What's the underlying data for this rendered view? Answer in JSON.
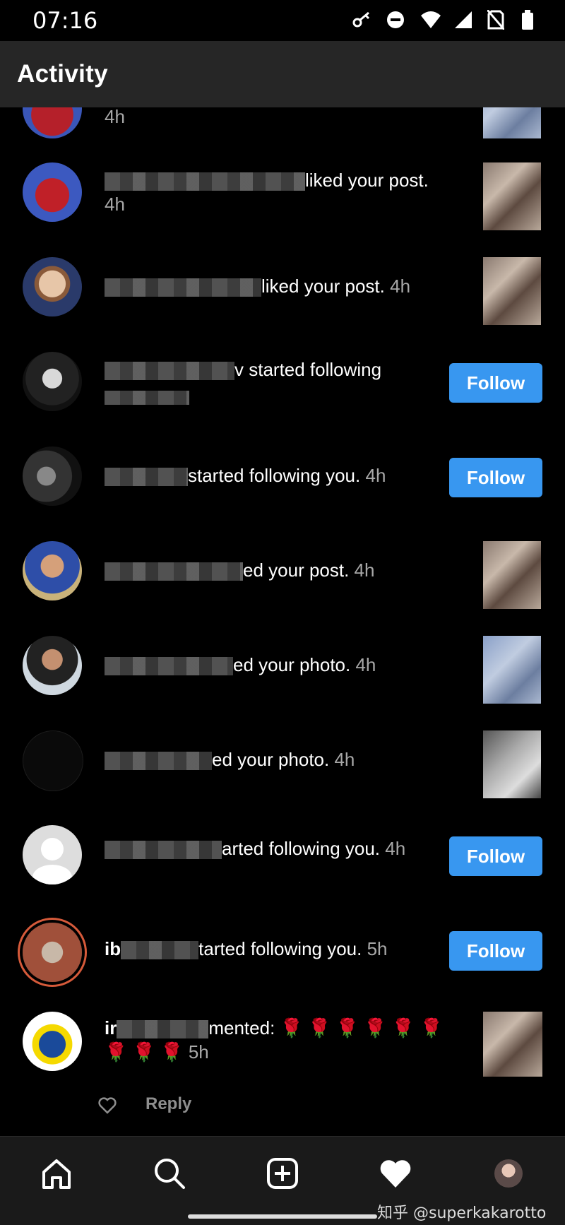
{
  "status_bar": {
    "time": "07:16"
  },
  "header": {
    "title": "Activity"
  },
  "notifications": [
    {
      "text": "",
      "time": "4h"
    },
    {
      "text": "liked your post.",
      "time": "4h"
    },
    {
      "text": "liked your post.",
      "time": "4h"
    },
    {
      "text": "v started following",
      "time": "",
      "action": "Follow"
    },
    {
      "text": "started following you.",
      "time": "4h",
      "action": "Follow"
    },
    {
      "text": "ed your post.",
      "time": "4h"
    },
    {
      "text": "ed your photo.",
      "time": "4h"
    },
    {
      "text": "ed your photo.",
      "time": "4h"
    },
    {
      "text": "arted following you.",
      "time": "4h",
      "action": "Follow"
    },
    {
      "text": "tarted following you.",
      "time": "5h",
      "action": "Follow",
      "prefix": "ib"
    },
    {
      "text": "mented: 🌹 🌹 🌹 🌹 🌹 🌹",
      "line2": "🌹 🌹 🌹",
      "time": "5h",
      "prefix": "ir"
    }
  ],
  "comment_actions": {
    "reply_label": "Reply"
  },
  "watermark": "知乎 @superkakarotto",
  "colors": {
    "follow_button": "#3897f0",
    "header_bg": "#262626",
    "nav_bg": "#1a1a1a"
  }
}
